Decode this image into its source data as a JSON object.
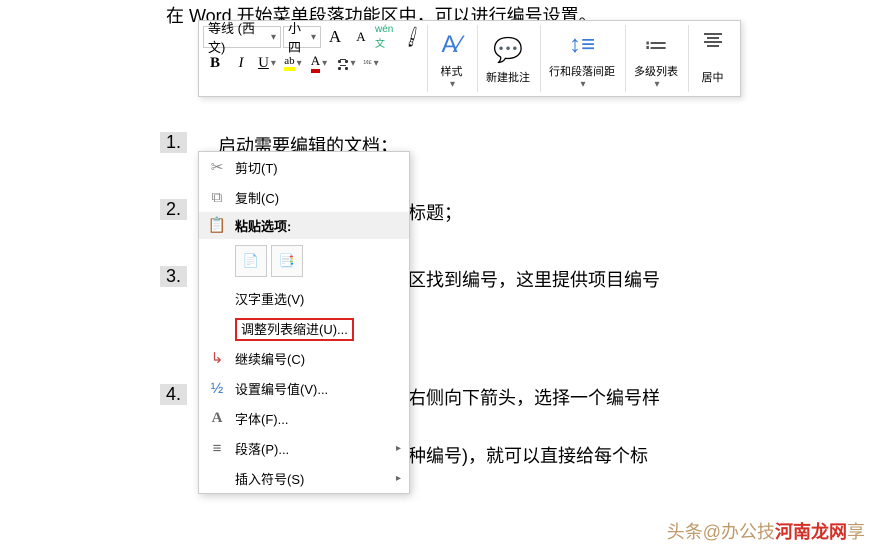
{
  "header_text": "在 Word 开始菜单段落功能区中，可以进行编号设置。",
  "list": {
    "num1": "1.",
    "text1": "启动需要编辑的文档；",
    "num2": "2.",
    "text2": "要编号的标题；",
    "num3": "3.",
    "text3": "段落功能区找到编号，这里提供项目编号",
    "num4": "4.",
    "text4": "点击编号右侧向下箭头，选择一个编号样",
    "text5": "第二章这种编号)，就可以直接给每个标"
  },
  "toolbar": {
    "font_name": "等线 (西文)",
    "font_size": "小四",
    "grow": "A",
    "shrink": "A",
    "phonetic": "wén 文",
    "bold": "B",
    "italic": "I",
    "underline": "U",
    "highlight": "ab",
    "fontcolor": "A",
    "styles": "样式",
    "comment": "新建批注",
    "spacing": "行和段落间距",
    "multilist": "多级列表",
    "center": "居中"
  },
  "menu": {
    "cut": "剪切(T)",
    "copy": "复制(C)",
    "paste_header": "粘贴选项:",
    "rechoose": "汉字重选(V)",
    "adjust_indent": "调整列表缩进(U)...",
    "continue_num": "继续编号(C)",
    "set_num": "设置编号值(V)...",
    "font": "字体(F)...",
    "paragraph": "段落(P)...",
    "insert_symbol": "插入符号(S)"
  },
  "watermark": {
    "prefix": "头条@办公技",
    "brand": "河南龙网",
    "suffix": "享"
  }
}
